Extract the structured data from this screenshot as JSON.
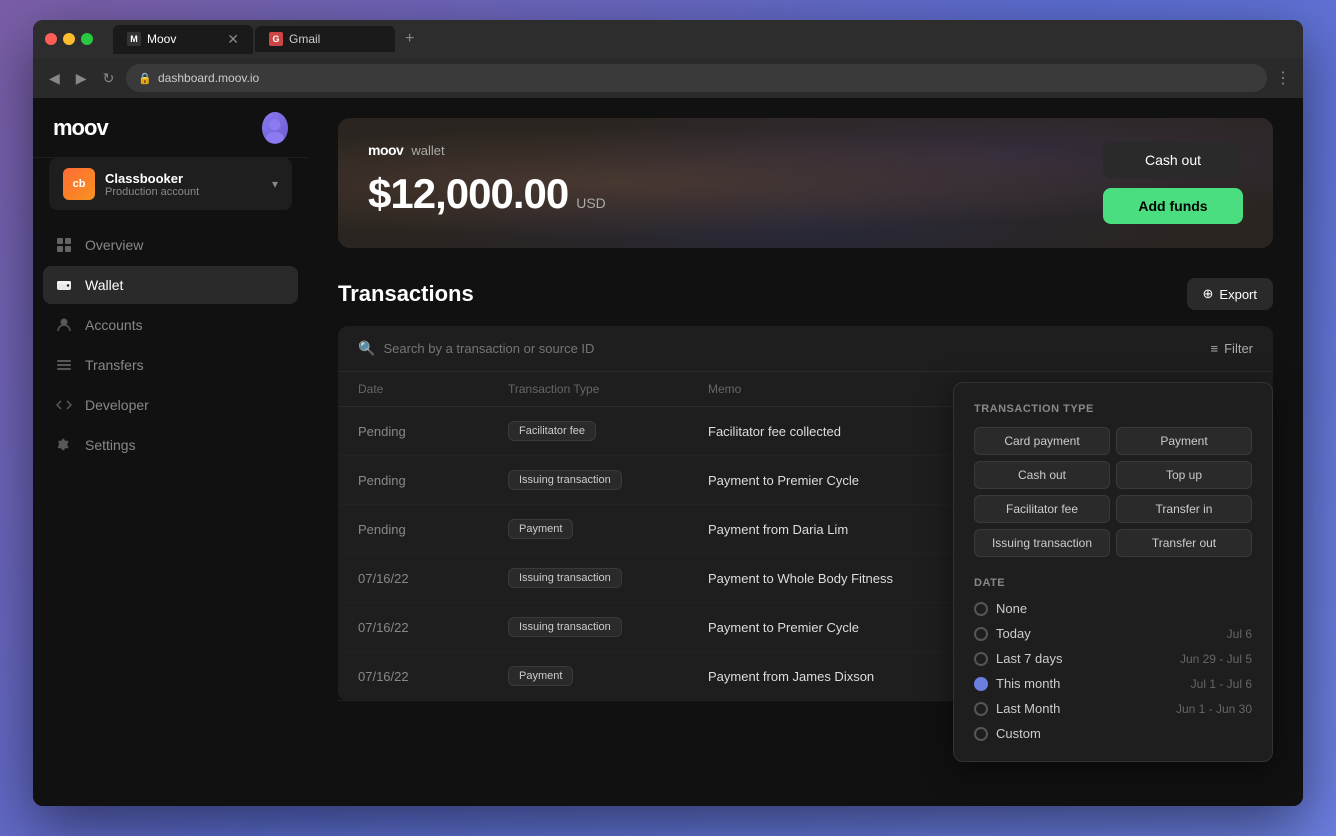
{
  "browser": {
    "url": "dashboard.moov.io",
    "tabs": [
      {
        "label": "Moov",
        "favicon": "M",
        "active": true
      },
      {
        "label": "Gmail",
        "favicon": "G",
        "active": false
      }
    ],
    "new_tab_label": "+"
  },
  "app": {
    "logo": "moov",
    "user_avatar_alt": "user avatar"
  },
  "sidebar": {
    "account": {
      "initials": "cb",
      "name": "Classbooker",
      "type": "Production account",
      "chevron": "▾"
    },
    "nav_items": [
      {
        "id": "overview",
        "label": "Overview",
        "icon": "grid"
      },
      {
        "id": "wallet",
        "label": "Wallet",
        "icon": "wallet",
        "active": true
      },
      {
        "id": "accounts",
        "label": "Accounts",
        "icon": "user"
      },
      {
        "id": "transfers",
        "label": "Transfers",
        "icon": "arrows"
      },
      {
        "id": "developer",
        "label": "Developer",
        "icon": "code"
      },
      {
        "id": "settings",
        "label": "Settings",
        "icon": "gear"
      }
    ]
  },
  "wallet_card": {
    "moov_label": "moov",
    "wallet_tag": "wallet",
    "balance": "$12,000.00",
    "currency": "USD",
    "cash_out_label": "Cash out",
    "add_funds_label": "Add funds"
  },
  "transactions": {
    "title": "Transactions",
    "export_label": "Export",
    "search_placeholder": "Search by a transaction or source ID",
    "filter_label": "Filter",
    "columns": [
      {
        "key": "date",
        "label": "Date"
      },
      {
        "key": "type",
        "label": "Transaction type"
      },
      {
        "key": "memo",
        "label": "Memo"
      }
    ],
    "rows": [
      {
        "date": "Pending",
        "type": "Facilitator fee",
        "memo": "Facilitator fee collected"
      },
      {
        "date": "Pending",
        "type": "Issuing transaction",
        "memo": "Payment to Premier Cycle"
      },
      {
        "date": "Pending",
        "type": "Payment",
        "memo": "Payment from Daria Lim"
      },
      {
        "date": "07/16/22",
        "type": "Issuing transaction",
        "memo": "Payment to Whole Body Fitness"
      },
      {
        "date": "07/16/22",
        "type": "Issuing transaction",
        "memo": "Payment to Premier Cycle"
      },
      {
        "date": "07/16/22",
        "type": "Payment",
        "memo": "Payment from James Dixson"
      }
    ],
    "filter_panel": {
      "transaction_type_label": "Transaction type",
      "types": [
        "Card payment",
        "Payment",
        "Cash out",
        "Top up",
        "Facilitator fee",
        "Transfer in",
        "Issuing transaction",
        "Transfer out"
      ],
      "date_label": "Date",
      "date_options": [
        {
          "label": "None",
          "range": ""
        },
        {
          "label": "Today",
          "range": "Jul 6"
        },
        {
          "label": "Last 7 days",
          "range": "Jun 29 - Jul 5"
        },
        {
          "label": "This month",
          "range": "Jul 1 - Jul 6"
        },
        {
          "label": "Last Month",
          "range": "Jun 1 - Jun 30"
        },
        {
          "label": "Custom",
          "range": ""
        }
      ]
    }
  }
}
